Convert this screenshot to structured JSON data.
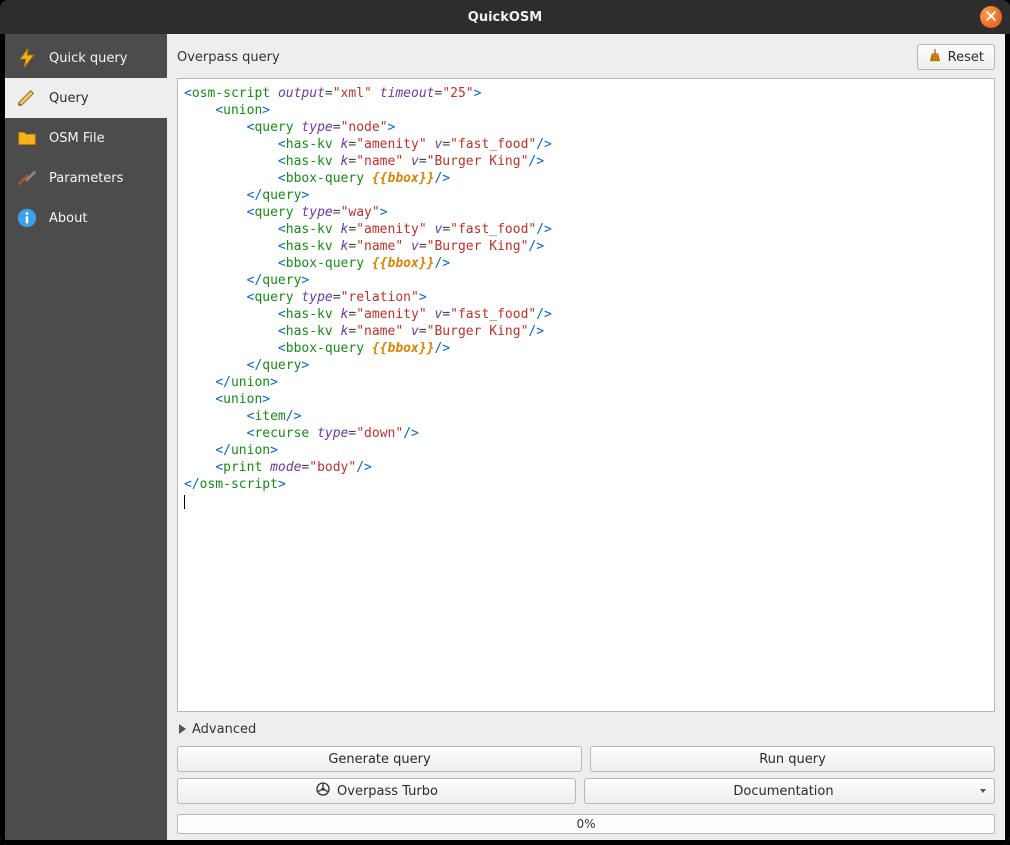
{
  "window": {
    "title": "QuickOSM"
  },
  "sidebar": {
    "items": [
      {
        "label": "Quick query"
      },
      {
        "label": "Query"
      },
      {
        "label": "OSM File"
      },
      {
        "label": "Parameters"
      },
      {
        "label": "About"
      }
    ],
    "selected_index": 1
  },
  "main": {
    "section_title": "Overpass query",
    "reset_label": "Reset",
    "advanced_label": "Advanced",
    "buttons": {
      "generate": "Generate query",
      "run": "Run query",
      "overpass_turbo": "Overpass Turbo",
      "documentation": "Documentation"
    },
    "progress_text": "0%"
  },
  "query": {
    "tokens": [
      [
        "b",
        "<"
      ],
      [
        "t",
        "osm-script"
      ],
      [
        "sp",
        " "
      ],
      [
        "a",
        "output"
      ],
      [
        "e",
        "="
      ],
      [
        "s",
        "\"xml\""
      ],
      [
        "sp",
        " "
      ],
      [
        "a",
        "timeout"
      ],
      [
        "e",
        "="
      ],
      [
        "s",
        "\"25\""
      ],
      [
        "b",
        ">"
      ],
      [
        "nl"
      ],
      [
        "sp",
        "    "
      ],
      [
        "b",
        "<"
      ],
      [
        "t",
        "union"
      ],
      [
        "b",
        ">"
      ],
      [
        "nl"
      ],
      [
        "sp",
        "        "
      ],
      [
        "b",
        "<"
      ],
      [
        "t",
        "query"
      ],
      [
        "sp",
        " "
      ],
      [
        "a",
        "type"
      ],
      [
        "e",
        "="
      ],
      [
        "s",
        "\"node\""
      ],
      [
        "b",
        ">"
      ],
      [
        "nl"
      ],
      [
        "sp",
        "            "
      ],
      [
        "b",
        "<"
      ],
      [
        "t",
        "has-kv"
      ],
      [
        "sp",
        " "
      ],
      [
        "a",
        "k"
      ],
      [
        "e",
        "="
      ],
      [
        "s",
        "\"amenity\""
      ],
      [
        "sp",
        " "
      ],
      [
        "a",
        "v"
      ],
      [
        "e",
        "="
      ],
      [
        "s",
        "\"fast_food\""
      ],
      [
        "b",
        "/>"
      ],
      [
        "nl"
      ],
      [
        "sp",
        "            "
      ],
      [
        "b",
        "<"
      ],
      [
        "t",
        "has-kv"
      ],
      [
        "sp",
        " "
      ],
      [
        "a",
        "k"
      ],
      [
        "e",
        "="
      ],
      [
        "s",
        "\"name\""
      ],
      [
        "sp",
        " "
      ],
      [
        "a",
        "v"
      ],
      [
        "e",
        "="
      ],
      [
        "s",
        "\"Burger King\""
      ],
      [
        "b",
        "/>"
      ],
      [
        "nl"
      ],
      [
        "sp",
        "            "
      ],
      [
        "b",
        "<"
      ],
      [
        "t",
        "bbox-query"
      ],
      [
        "sp",
        " "
      ],
      [
        "m",
        "{{bbox}}"
      ],
      [
        "b",
        "/>"
      ],
      [
        "nl"
      ],
      [
        "sp",
        "        "
      ],
      [
        "b",
        "</"
      ],
      [
        "t",
        "query"
      ],
      [
        "b",
        ">"
      ],
      [
        "nl"
      ],
      [
        "sp",
        "        "
      ],
      [
        "b",
        "<"
      ],
      [
        "t",
        "query"
      ],
      [
        "sp",
        " "
      ],
      [
        "a",
        "type"
      ],
      [
        "e",
        "="
      ],
      [
        "s",
        "\"way\""
      ],
      [
        "b",
        ">"
      ],
      [
        "nl"
      ],
      [
        "sp",
        "            "
      ],
      [
        "b",
        "<"
      ],
      [
        "t",
        "has-kv"
      ],
      [
        "sp",
        " "
      ],
      [
        "a",
        "k"
      ],
      [
        "e",
        "="
      ],
      [
        "s",
        "\"amenity\""
      ],
      [
        "sp",
        " "
      ],
      [
        "a",
        "v"
      ],
      [
        "e",
        "="
      ],
      [
        "s",
        "\"fast_food\""
      ],
      [
        "b",
        "/>"
      ],
      [
        "nl"
      ],
      [
        "sp",
        "            "
      ],
      [
        "b",
        "<"
      ],
      [
        "t",
        "has-kv"
      ],
      [
        "sp",
        " "
      ],
      [
        "a",
        "k"
      ],
      [
        "e",
        "="
      ],
      [
        "s",
        "\"name\""
      ],
      [
        "sp",
        " "
      ],
      [
        "a",
        "v"
      ],
      [
        "e",
        "="
      ],
      [
        "s",
        "\"Burger King\""
      ],
      [
        "b",
        "/>"
      ],
      [
        "nl"
      ],
      [
        "sp",
        "            "
      ],
      [
        "b",
        "<"
      ],
      [
        "t",
        "bbox-query"
      ],
      [
        "sp",
        " "
      ],
      [
        "m",
        "{{bbox}}"
      ],
      [
        "b",
        "/>"
      ],
      [
        "nl"
      ],
      [
        "sp",
        "        "
      ],
      [
        "b",
        "</"
      ],
      [
        "t",
        "query"
      ],
      [
        "b",
        ">"
      ],
      [
        "nl"
      ],
      [
        "sp",
        "        "
      ],
      [
        "b",
        "<"
      ],
      [
        "t",
        "query"
      ],
      [
        "sp",
        " "
      ],
      [
        "a",
        "type"
      ],
      [
        "e",
        "="
      ],
      [
        "s",
        "\"relation\""
      ],
      [
        "b",
        ">"
      ],
      [
        "nl"
      ],
      [
        "sp",
        "            "
      ],
      [
        "b",
        "<"
      ],
      [
        "t",
        "has-kv"
      ],
      [
        "sp",
        " "
      ],
      [
        "a",
        "k"
      ],
      [
        "e",
        "="
      ],
      [
        "s",
        "\"amenity\""
      ],
      [
        "sp",
        " "
      ],
      [
        "a",
        "v"
      ],
      [
        "e",
        "="
      ],
      [
        "s",
        "\"fast_food\""
      ],
      [
        "b",
        "/>"
      ],
      [
        "nl"
      ],
      [
        "sp",
        "            "
      ],
      [
        "b",
        "<"
      ],
      [
        "t",
        "has-kv"
      ],
      [
        "sp",
        " "
      ],
      [
        "a",
        "k"
      ],
      [
        "e",
        "="
      ],
      [
        "s",
        "\"name\""
      ],
      [
        "sp",
        " "
      ],
      [
        "a",
        "v"
      ],
      [
        "e",
        "="
      ],
      [
        "s",
        "\"Burger King\""
      ],
      [
        "b",
        "/>"
      ],
      [
        "nl"
      ],
      [
        "sp",
        "            "
      ],
      [
        "b",
        "<"
      ],
      [
        "t",
        "bbox-query"
      ],
      [
        "sp",
        " "
      ],
      [
        "m",
        "{{bbox}}"
      ],
      [
        "b",
        "/>"
      ],
      [
        "nl"
      ],
      [
        "sp",
        "        "
      ],
      [
        "b",
        "</"
      ],
      [
        "t",
        "query"
      ],
      [
        "b",
        ">"
      ],
      [
        "nl"
      ],
      [
        "sp",
        "    "
      ],
      [
        "b",
        "</"
      ],
      [
        "t",
        "union"
      ],
      [
        "b",
        ">"
      ],
      [
        "nl"
      ],
      [
        "sp",
        "    "
      ],
      [
        "b",
        "<"
      ],
      [
        "t",
        "union"
      ],
      [
        "b",
        ">"
      ],
      [
        "nl"
      ],
      [
        "sp",
        "        "
      ],
      [
        "b",
        "<"
      ],
      [
        "t",
        "item"
      ],
      [
        "b",
        "/>"
      ],
      [
        "nl"
      ],
      [
        "sp",
        "        "
      ],
      [
        "b",
        "<"
      ],
      [
        "t",
        "recurse"
      ],
      [
        "sp",
        " "
      ],
      [
        "a",
        "type"
      ],
      [
        "e",
        "="
      ],
      [
        "s",
        "\"down\""
      ],
      [
        "b",
        "/>"
      ],
      [
        "nl"
      ],
      [
        "sp",
        "    "
      ],
      [
        "b",
        "</"
      ],
      [
        "t",
        "union"
      ],
      [
        "b",
        ">"
      ],
      [
        "nl"
      ],
      [
        "sp",
        "    "
      ],
      [
        "b",
        "<"
      ],
      [
        "t",
        "print"
      ],
      [
        "sp",
        " "
      ],
      [
        "a",
        "mode"
      ],
      [
        "e",
        "="
      ],
      [
        "s",
        "\"body\""
      ],
      [
        "b",
        "/>"
      ],
      [
        "nl"
      ],
      [
        "b",
        "</"
      ],
      [
        "t",
        "osm-script"
      ],
      [
        "b",
        ">"
      ],
      [
        "nl"
      ]
    ]
  }
}
